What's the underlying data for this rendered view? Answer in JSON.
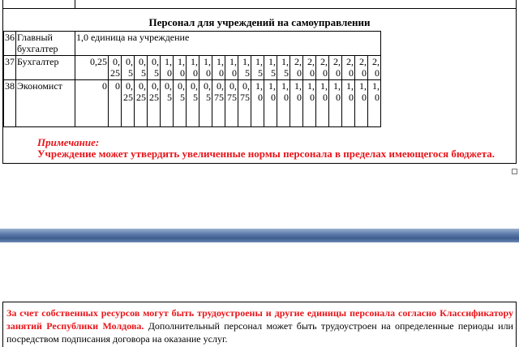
{
  "section_title": "Персонал для учреждений на самоуправлении",
  "rows": [
    {
      "num": "36",
      "name": "Главный бухгалтер",
      "merged": "1,0 единица на учреждение"
    },
    {
      "num": "37",
      "name": "Бухгалтер",
      "first": "0,25",
      "values": [
        "0,25",
        "0,5",
        "0,5",
        "0,5",
        "1,0",
        "1,0",
        "1,0",
        "1,0",
        "1,0",
        "1,0",
        "1,5",
        "1,5",
        "1,5",
        "1,5",
        "2,0",
        "2,0",
        "2,0",
        "2,0",
        "2,0",
        "2,0",
        "2,0"
      ]
    },
    {
      "num": "38",
      "name": "Экономист",
      "first": "0",
      "values": [
        "0",
        "0,25",
        "0,25",
        "0,25",
        "0,5",
        "0,5",
        "0,5",
        "0,5",
        "0,75",
        "0,75",
        "0,75",
        "1,0",
        "1,0",
        "1,0",
        "1,0",
        "1,0",
        "1,0",
        "1,0",
        "1,0",
        "1,0",
        "1,0"
      ]
    }
  ],
  "note": {
    "label": "Примечание:",
    "text": "Учреждение может утвердить увеличенные нормы персонала в пределах имеющегося бюджета."
  },
  "bottom": {
    "red_text": "За счет собственных ресурсов могут быть трудоустроены и другие единицы персонала согласно Классификатору занятий Республики Молдова.",
    "black_text": "Дополнительный персонал может быть трудоустроен на определенные периоды или посредством подписания договора на оказание услуг."
  },
  "colors": {
    "accent_red": "#e8151a",
    "ribbon_blue": "#4a6a9c"
  }
}
